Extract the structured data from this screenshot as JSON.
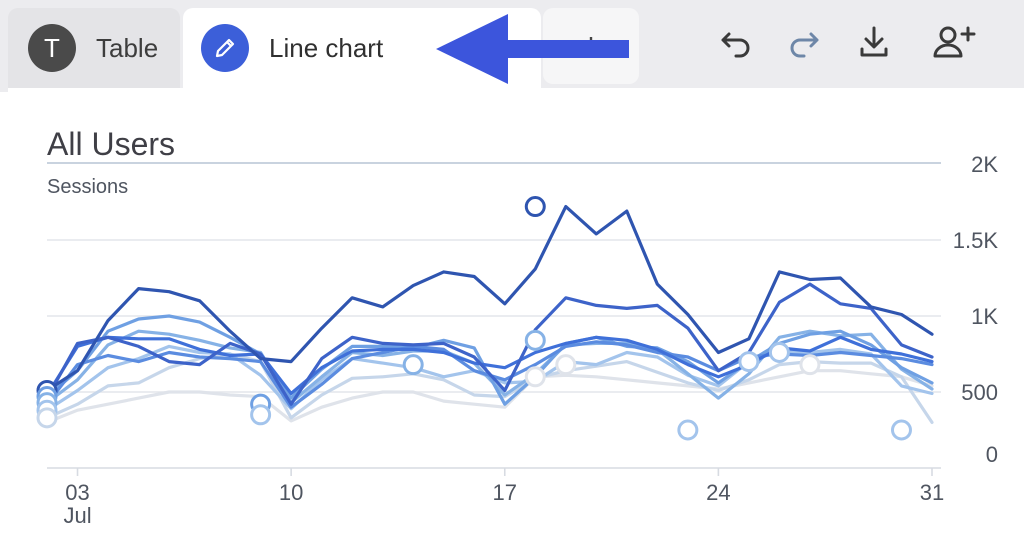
{
  "tabs": [
    {
      "label": "Table",
      "icon_letter": "T"
    },
    {
      "label": "Line chart",
      "icon": "pencil-icon"
    }
  ],
  "toolbar": {
    "add_tab_icon": "plus-icon",
    "undo_icon": "undo-icon",
    "redo_icon": "redo-icon",
    "download_icon": "download-icon",
    "share_icon": "add-user-icon"
  },
  "colors": {
    "accent": "#3c5fd9",
    "annotation_arrow": "#3c55dc",
    "series_palette": [
      "#2f55b0",
      "#3d63c9",
      "#3f70d9",
      "#5b8ce0",
      "#6fa0e3",
      "#86b2e6",
      "#a3c4ec",
      "#c6d6ea",
      "#dfe3ea"
    ]
  },
  "chart_data": {
    "type": "line",
    "title": "All Users",
    "ylabel": "Sessions",
    "ylim": [
      0,
      2000
    ],
    "y_ticks": [
      "0",
      "500",
      "1K",
      "1.5K",
      "2K"
    ],
    "y_tick_values": [
      0,
      500,
      1000,
      1500,
      2000
    ],
    "y_axis_side": "right",
    "x_tick_labels": [
      "03",
      "10",
      "17",
      "24",
      "31"
    ],
    "x_tick_values": [
      3,
      10,
      17,
      24,
      31
    ],
    "x_month_label": "Jul",
    "x": [
      2,
      3,
      4,
      5,
      6,
      7,
      8,
      9,
      10,
      11,
      12,
      13,
      14,
      15,
      16,
      17,
      18,
      19,
      20,
      21,
      22,
      23,
      24,
      25,
      26,
      27,
      28,
      29,
      30,
      31
    ],
    "grid": "horizontal",
    "series": [
      {
        "values": [
          510,
          640,
          970,
          1180,
          1160,
          1100,
          900,
          720,
          700,
          920,
          1120,
          1060,
          1200,
          1290,
          1260,
          1080,
          1310,
          1720,
          1540,
          1690,
          1210,
          1010,
          760,
          850,
          1290,
          1240,
          1250,
          1060,
          1010,
          880
        ],
        "marker_points": [
          [
            2,
            510
          ],
          [
            18,
            1720
          ]
        ]
      },
      {
        "values": [
          460,
          820,
          860,
          800,
          700,
          680,
          820,
          750,
          420,
          720,
          860,
          820,
          810,
          820,
          730,
          510,
          910,
          1120,
          1070,
          1050,
          1070,
          920,
          640,
          760,
          1090,
          1210,
          1080,
          1050,
          810,
          730
        ]
      },
      {
        "values": [
          480,
          800,
          860,
          850,
          850,
          780,
          740,
          750,
          490,
          660,
          770,
          780,
          780,
          760,
          690,
          660,
          760,
          820,
          860,
          840,
          780,
          680,
          600,
          680,
          790,
          770,
          860,
          780,
          750,
          700
        ]
      },
      {
        "values": [
          420,
          680,
          740,
          700,
          760,
          730,
          720,
          700,
          400,
          550,
          720,
          760,
          800,
          780,
          640,
          580,
          680,
          800,
          830,
          810,
          760,
          730,
          640,
          730,
          750,
          740,
          760,
          740,
          720,
          680
        ]
      },
      {
        "values": [
          470,
          640,
          900,
          980,
          1000,
          960,
          860,
          750,
          460,
          650,
          800,
          800,
          790,
          840,
          790,
          420,
          600,
          820,
          860,
          800,
          790,
          700,
          560,
          700,
          820,
          880,
          900,
          810,
          660,
          560
        ],
        "marker_points": [
          [
            2,
            470
          ],
          [
            9,
            420
          ]
        ]
      },
      {
        "values": [
          430,
          580,
          810,
          900,
          880,
          840,
          790,
          760,
          430,
          600,
          760,
          740,
          770,
          770,
          690,
          480,
          620,
          810,
          820,
          820,
          780,
          620,
          460,
          620,
          860,
          900,
          870,
          880,
          650,
          520
        ],
        "marker_points": [
          [
            2,
            430
          ],
          [
            14,
            680
          ],
          [
            18,
            840
          ]
        ]
      },
      {
        "values": [
          380,
          510,
          660,
          720,
          800,
          760,
          750,
          610,
          390,
          580,
          720,
          690,
          660,
          600,
          640,
          560,
          570,
          700,
          680,
          760,
          730,
          610,
          540,
          700,
          770,
          760,
          780,
          750,
          540,
          490
        ],
        "marker_points": [
          [
            2,
            380
          ],
          [
            9,
            350
          ],
          [
            23,
            250
          ],
          [
            25,
            700
          ],
          [
            26,
            760
          ],
          [
            30,
            250
          ]
        ]
      },
      {
        "values": [
          330,
          420,
          540,
          560,
          660,
          720,
          750,
          700,
          330,
          480,
          590,
          600,
          620,
          580,
          480,
          470,
          590,
          640,
          670,
          700,
          630,
          560,
          510,
          580,
          680,
          700,
          690,
          690,
          600,
          300
        ],
        "marker_points": [
          [
            2,
            330
          ]
        ]
      },
      {
        "values": [
          300,
          380,
          420,
          460,
          500,
          500,
          480,
          470,
          310,
          400,
          460,
          500,
          500,
          440,
          420,
          400,
          600,
          610,
          600,
          580,
          560,
          540,
          520,
          560,
          600,
          640,
          640,
          620,
          600,
          540
        ],
        "marker_points": [
          [
            18,
            600
          ],
          [
            19,
            680
          ],
          [
            27,
            680
          ]
        ]
      }
    ]
  }
}
